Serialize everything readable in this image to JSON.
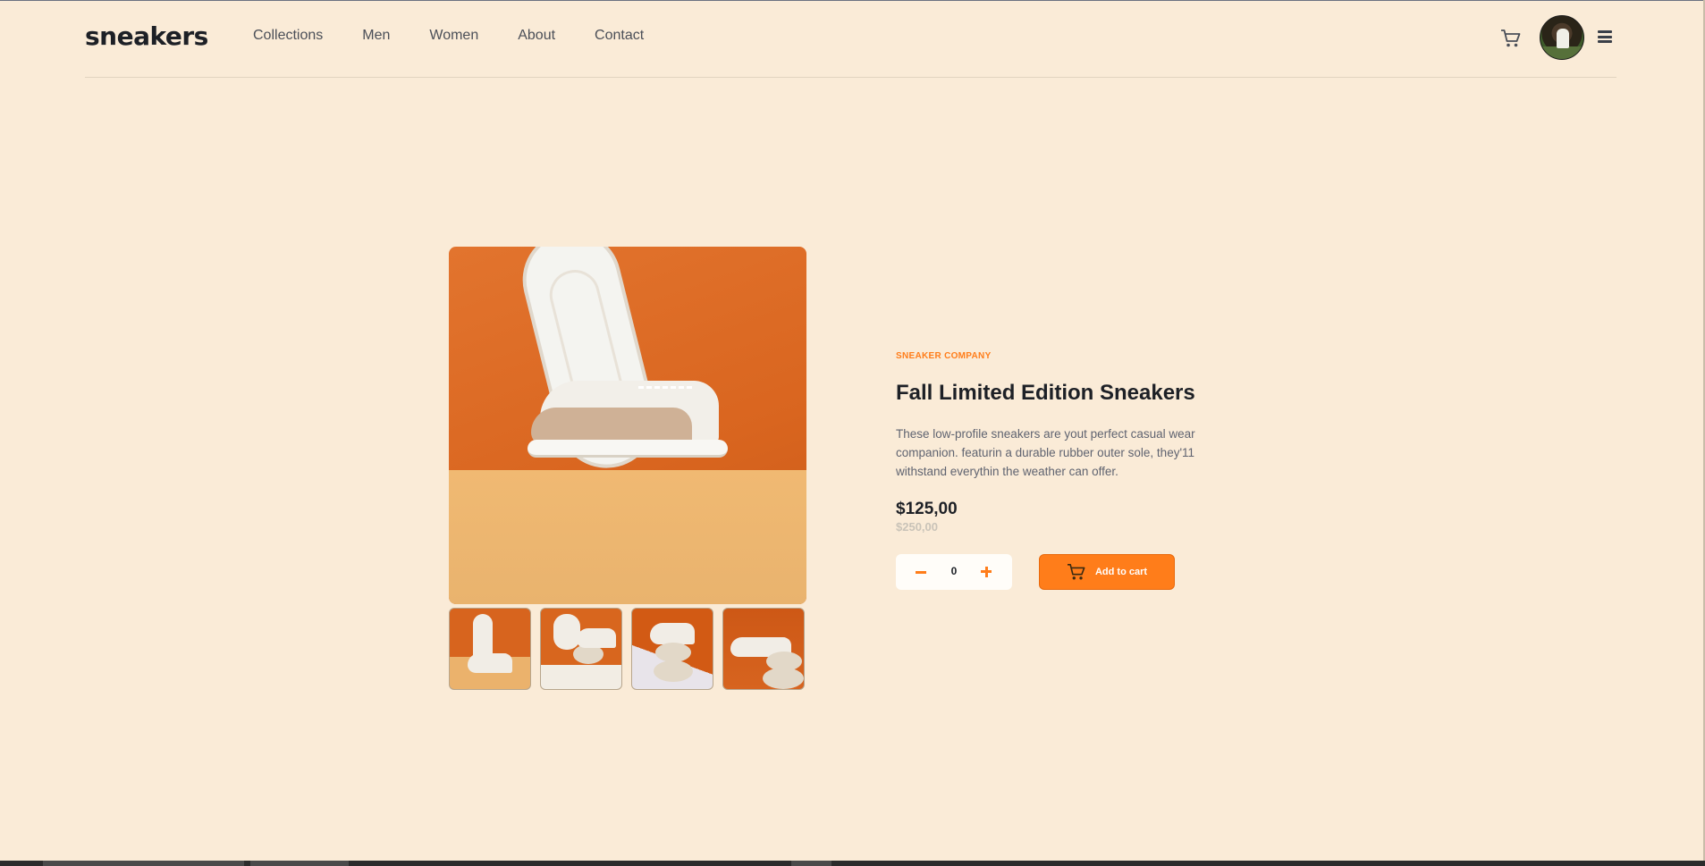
{
  "brand": {
    "logo": "sneakers"
  },
  "nav": {
    "items": [
      "Collections",
      "Men",
      "Women",
      "About",
      "Contact"
    ]
  },
  "product": {
    "company": "SNEAKER COMPANY",
    "title": "Fall Limited Edition Sneakers",
    "description": "These low-profile sneakers are yout perfect casual wear companion. featurin a durable rubber outer sole, they'11 withstand everythin the weather can offer.",
    "price": "$125,00",
    "original_price": "$250,00",
    "quantity": "0",
    "add_to_cart_label": "Add to cart"
  },
  "colors": {
    "accent": "#ff7d1a",
    "background": "#faebd7",
    "text": "#1d2026"
  },
  "icons": [
    "cart-icon",
    "avatar",
    "hamburger-menu-icon",
    "minus-icon",
    "plus-icon"
  ]
}
